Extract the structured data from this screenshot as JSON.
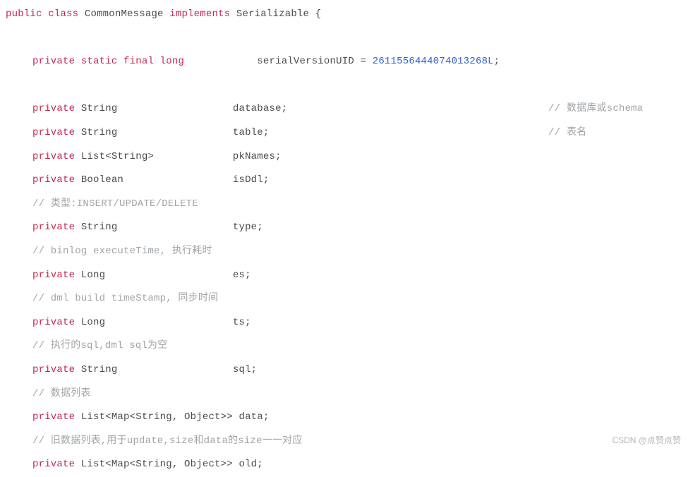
{
  "class_decl": {
    "kw_public": "public",
    "kw_class": "class",
    "name": "CommonMessage",
    "kw_implements": "implements",
    "iface": "Serializable",
    "open": "{"
  },
  "svuid": {
    "kw_private": "private",
    "kw_static": "static",
    "kw_final": "final",
    "kw_long": "long",
    "name": "serialVersionUID",
    "eq": "=",
    "value": "2611556444074013268L",
    "semi": ";"
  },
  "fields": {
    "database": {
      "kw": "private",
      "type": "String",
      "name": "database;",
      "comment": "// 数据库或schema"
    },
    "table": {
      "kw": "private",
      "type": "String",
      "name": "table;",
      "comment": "// 表名"
    },
    "pkNames": {
      "kw": "private",
      "type": "List<String>",
      "name": "pkNames;"
    },
    "isDdl": {
      "kw": "private",
      "type": "Boolean",
      "name": "isDdl;"
    },
    "typeCmt": "// 类型:INSERT/UPDATE/DELETE",
    "type": {
      "kw": "private",
      "type": "String",
      "name": "type;"
    },
    "esCmt": "// binlog executeTime, 执行耗时",
    "es": {
      "kw": "private",
      "type": "Long",
      "name": "es;"
    },
    "tsCmt": "// dml build timeStamp, 同步时间",
    "ts": {
      "kw": "private",
      "type": "Long",
      "name": "ts;"
    },
    "sqlCmt": "// 执行的sql,dml sql为空",
    "sql": {
      "kw": "private",
      "type": "String",
      "name": "sql;"
    },
    "dataCmt": "// 数据列表",
    "data": {
      "kw": "private",
      "type": "List<Map<String, Object>>",
      "name": "data;"
    },
    "oldCmt": "// 旧数据列表,用于update,size和data的size一一对应",
    "old": {
      "kw": "private",
      "type": "List<Map<String, Object>>",
      "name": "old;"
    }
  },
  "watermark": "CSDN @点赞点赞"
}
